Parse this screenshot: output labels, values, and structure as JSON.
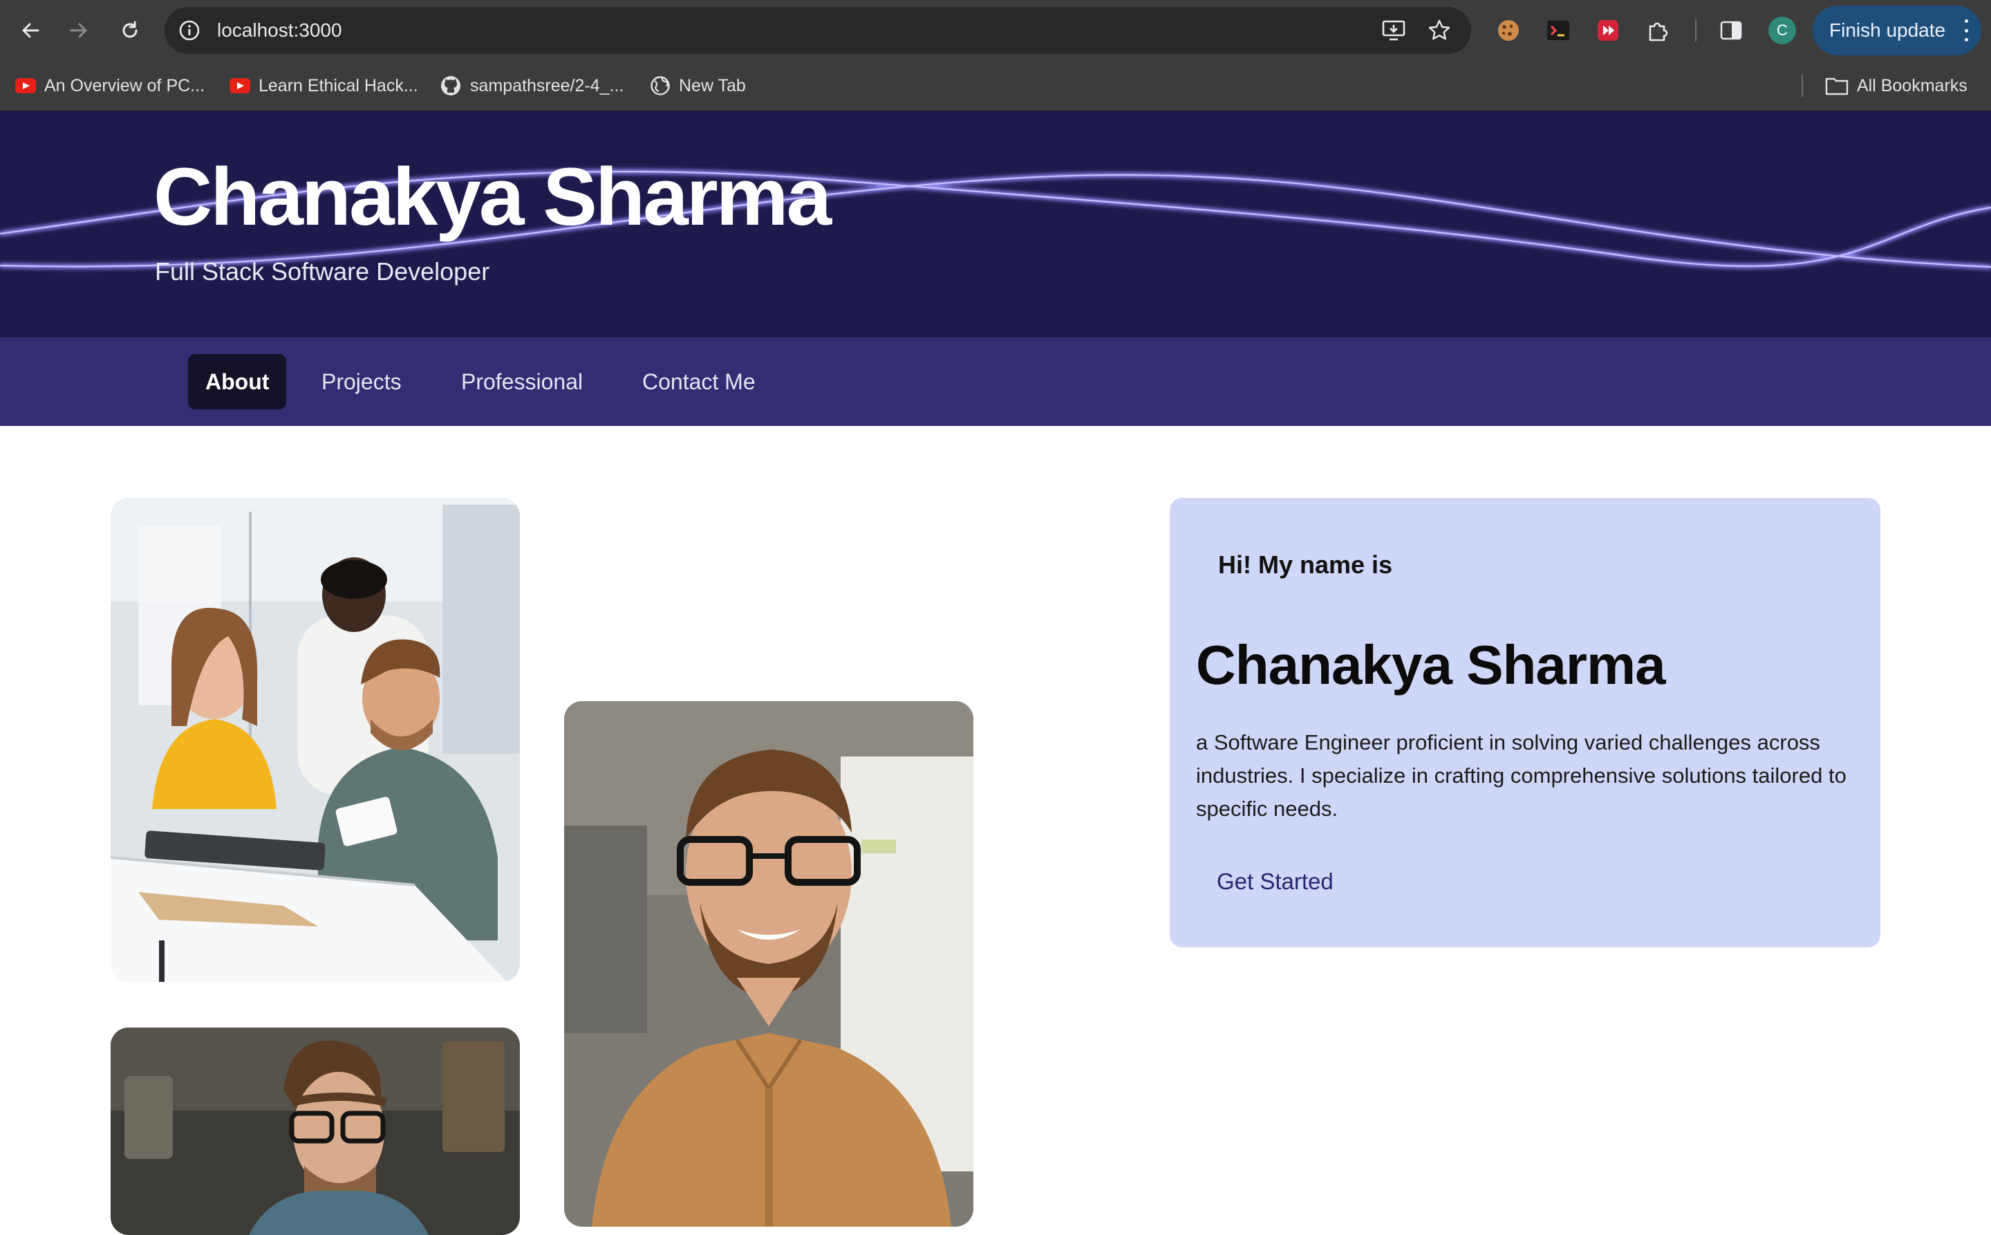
{
  "browser": {
    "url": "localhost:3000",
    "avatar_letter": "C",
    "finish_update_label": "Finish update",
    "bookmarks": [
      {
        "label": "An Overview of PC..."
      },
      {
        "label": "Learn Ethical Hack..."
      },
      {
        "label": "sampathsree/2-4_..."
      },
      {
        "label": "New Tab"
      }
    ],
    "all_bookmarks_label": "All Bookmarks"
  },
  "header": {
    "title": "Chanakya Sharma",
    "subtitle": "Full Stack Software Developer"
  },
  "nav": {
    "tabs": [
      {
        "label": "About",
        "active": true
      },
      {
        "label": "Projects",
        "active": false
      },
      {
        "label": "Professional",
        "active": false
      },
      {
        "label": "Contact Me",
        "active": false
      }
    ]
  },
  "intro": {
    "greeting": "Hi! My name is",
    "name": "Chanakya Sharma",
    "description": "a Software Engineer proficient in solving varied challenges across industries. I specialize in crafting comprehensive solutions tailored to specific needs.",
    "cta": "Get Started"
  },
  "colors": {
    "header_bg": "#1e1b4c",
    "nav_bg": "#342d73",
    "active_tab_bg": "#141229",
    "card_bg": "#cfd7f8",
    "wave": "#8f86f2",
    "cta_text": "#2a2470"
  }
}
